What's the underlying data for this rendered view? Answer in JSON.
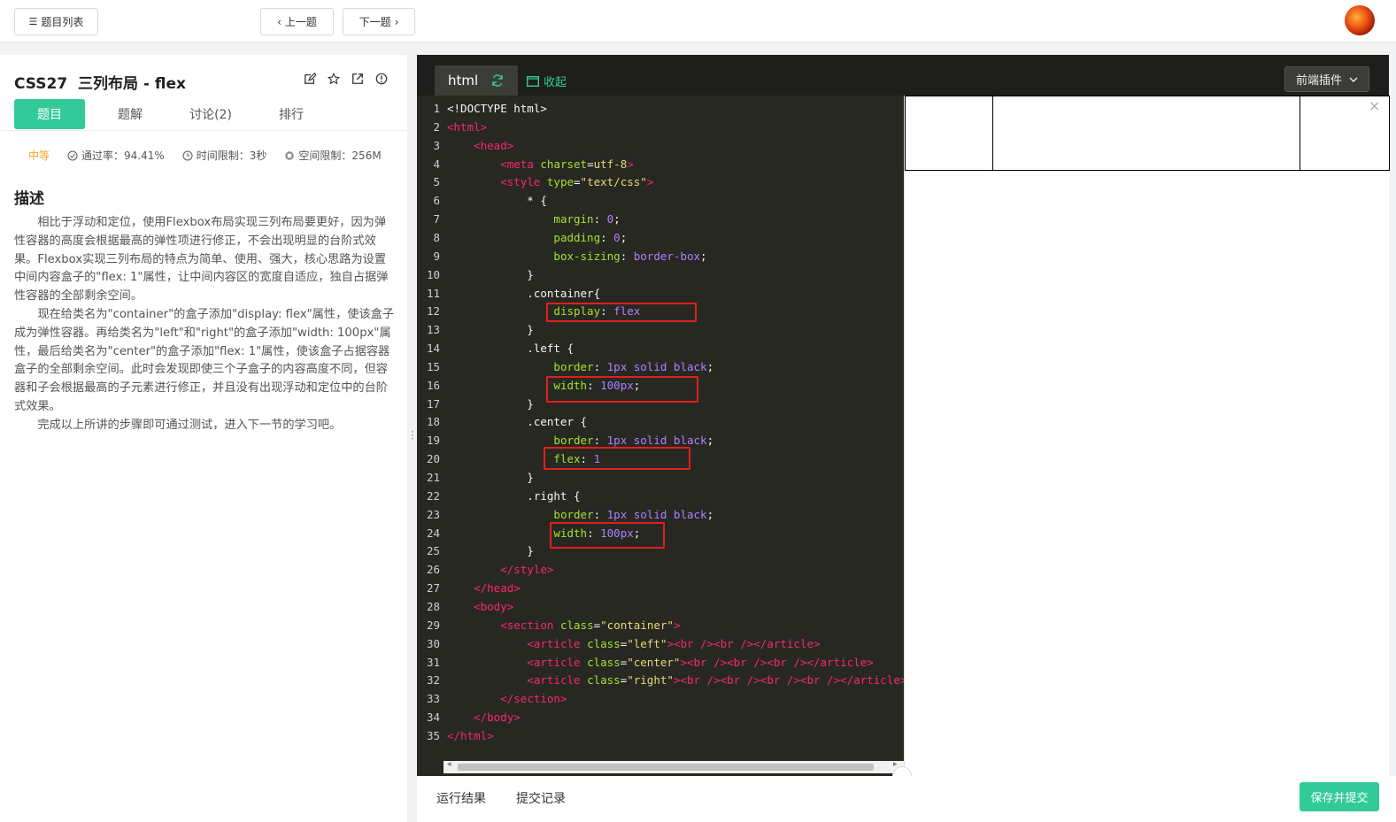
{
  "topbar": {
    "list_label": "题目列表",
    "prev_label": "上一题",
    "next_label": "下一题"
  },
  "problem": {
    "title": "CSS27  三列布局 - flex",
    "tabs": [
      "题目",
      "题解",
      "讨论(2)",
      "排行"
    ],
    "difficulty": "中等",
    "pass_rate": "通过率：94.41%",
    "time_limit": "时间限制：3秒",
    "space_limit": "空间限制：256M",
    "desc_heading": "描述",
    "desc_paragraphs": [
      "相比于浮动和定位，使用Flexbox布局实现三列布局要更好，因为弹性容器的高度会根据最高的弹性项进行修正，不会出现明显的台阶式效果。Flexbox实现三列布局的特点为简单、使用、强大，核心思路为设置中间内容盒子的\"flex: 1\"属性，让中间内容区的宽度自适应，独自占据弹性容器的全部剩余空间。",
      "现在给类名为\"container\"的盒子添加\"display: flex\"属性，使该盒子成为弹性容器。再给类名为\"left\"和\"right\"的盒子添加\"width: 100px\"属性，最后给类名为\"center\"的盒子添加\"flex: 1\"属性，使该盒子占据容器盒子的全部剩余空间。此时会发现即使三个子盒子的内容高度不同，但容器和子会根据最高的子元素进行修正，并且没有出现浮动和定位中的台阶式效果。",
      "完成以上所讲的步骤即可通过测试，进入下一节的学习吧。"
    ]
  },
  "editor": {
    "tab_label": "html",
    "collapse_label": "收起",
    "plugin_label": "前端插件",
    "code_lines": [
      "<!DOCTYPE html>",
      "<html>",
      "    <head>",
      "        <meta charset=utf-8>",
      "        <style type=\"text/css\">",
      "            * {",
      "                margin: 0;",
      "                padding: 0;",
      "                box-sizing: border-box;",
      "            }",
      "            .container{",
      "                display: flex",
      "            }",
      "            .left {",
      "                border: 1px solid black;",
      "                width: 100px;",
      "            }",
      "            .center {",
      "                border: 1px solid black;",
      "                flex: 1",
      "            }",
      "            .right {",
      "                border: 1px solid black;",
      "                width: 100px;",
      "            }",
      "        </style>",
      "    </head>",
      "    <body>",
      "        <section class=\"container\">",
      "            <article class=\"left\"><br /><br /></article>",
      "            <article class=\"center\"><br /><br /><br /></article>",
      "            <article class=\"right\"><br /><br /><br /><br /></article>",
      "        </section>",
      "    </body>",
      "</html>"
    ]
  },
  "bottom": {
    "result_label": "运行结果",
    "history_label": "提交记录",
    "submit_label": "保存并提交"
  },
  "colors": {
    "accent": "#32ca99",
    "editor_bg": "#272822",
    "highlight_box": "#e0201b"
  }
}
